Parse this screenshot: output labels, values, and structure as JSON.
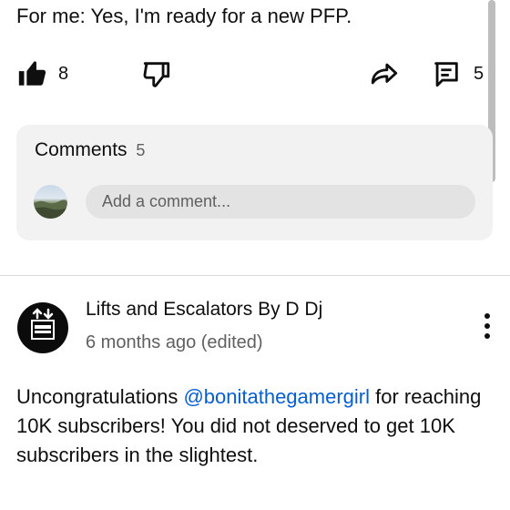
{
  "post": {
    "text": "For me: Yes, I'm ready for a new PFP."
  },
  "actions": {
    "like_count": "8",
    "comment_count": "5",
    "icons": [
      "thumbs-up-icon",
      "thumbs-down-icon",
      "share-icon",
      "comment-icon"
    ]
  },
  "comments": {
    "title": "Comments",
    "count": "5",
    "placeholder": "Add a comment..."
  },
  "comment": {
    "author": "Lifts and Escalators By D Dj",
    "time": "6 months ago (edited)",
    "text_before": "Uncongratulations ",
    "mention": "@bonitathegamergirl",
    "text_after": " for reaching 10K subscribers! You did not deserved to get 10K subscribers in the slightest."
  },
  "colors": {
    "mention": "#065fd4",
    "card_bg": "#f2f2f2"
  }
}
